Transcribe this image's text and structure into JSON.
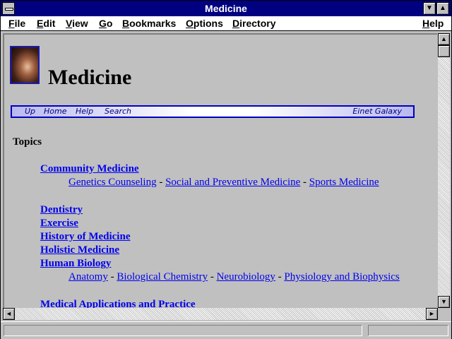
{
  "window": {
    "title": "Medicine",
    "minimize_glyph": "▼",
    "maximize_glyph": "▲"
  },
  "menu": [
    "File",
    "Edit",
    "View",
    "Go",
    "Bookmarks",
    "Options",
    "Directory",
    "Help"
  ],
  "page": {
    "title": "Medicine",
    "nav": [
      "Up",
      "Home",
      "Help",
      "Search"
    ],
    "nav_right": "Einet Galaxy",
    "topics_heading": "Topics",
    "categories": {
      "community": "Community Medicine",
      "dentistry": "Dentistry",
      "exercise": "Exercise",
      "history": "History of Medicine",
      "holistic": "Holistic Medicine",
      "human_biology": "Human Biology",
      "medical_applications": "Medical Applications and Practice"
    },
    "community_sub": [
      "Genetics Counseling",
      "Social and Preventive Medicine",
      "Sports Medicine"
    ],
    "human_biology_sub": [
      "Anatomy",
      "Biological Chemistry",
      "Neurobiology",
      "Physiology and Biophysics"
    ],
    "separator": " - "
  },
  "scroll_glyphs": {
    "up": "▲",
    "down": "▼",
    "left": "◄",
    "right": "►"
  },
  "status": {
    "text": ""
  }
}
